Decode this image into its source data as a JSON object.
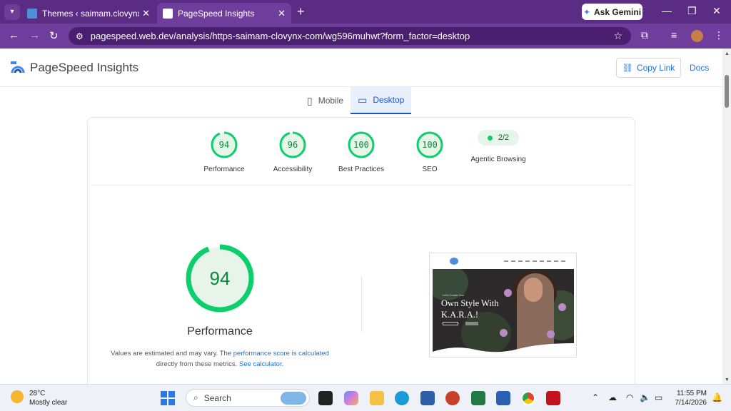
{
  "browser": {
    "tabs": [
      {
        "title": "Themes ‹ saimam.clovynx.com",
        "active": false
      },
      {
        "title": "PageSpeed Insights",
        "active": true
      }
    ],
    "new_tab": "+",
    "ask_gemini": "Ask Gemini",
    "address": "pagespeed.web.dev/analysis/https-saimam-clovynx-com/wg596muhwt?form_factor=desktop",
    "accent": "#5b2c83"
  },
  "header": {
    "title": "PageSpeed Insights",
    "copy_link": "Copy Link",
    "docs": "Docs"
  },
  "device_tabs": [
    {
      "label": "Mobile",
      "icon": "phone-icon",
      "active": false
    },
    {
      "label": "Desktop",
      "icon": "laptop-icon",
      "active": true
    }
  ],
  "scores": [
    {
      "label": "Performance",
      "value": "94"
    },
    {
      "label": "Accessibility",
      "value": "96"
    },
    {
      "label": "Best Practices",
      "value": "100"
    },
    {
      "label": "SEO",
      "value": "100"
    }
  ],
  "agentic": {
    "label": "Agentic Browsing",
    "value": "2/2"
  },
  "performance": {
    "score": "94",
    "title": "Performance",
    "note_prefix": "Values are estimated and may vary. The ",
    "note_link1": "performance score is calculated",
    "note_mid": " directly from these metrics. ",
    "note_link2": "See calculator",
    "note_suffix": "."
  },
  "screenshot": {
    "eyebrow": "Let's Create Your",
    "headline_line1": "Own Style With",
    "headline_line2": "K.A.R.A.!"
  },
  "taskbar": {
    "temp": "28°C",
    "weather": "Mostly clear",
    "search": "Search",
    "time": "11:55 PM",
    "date": "7/14/2026"
  }
}
